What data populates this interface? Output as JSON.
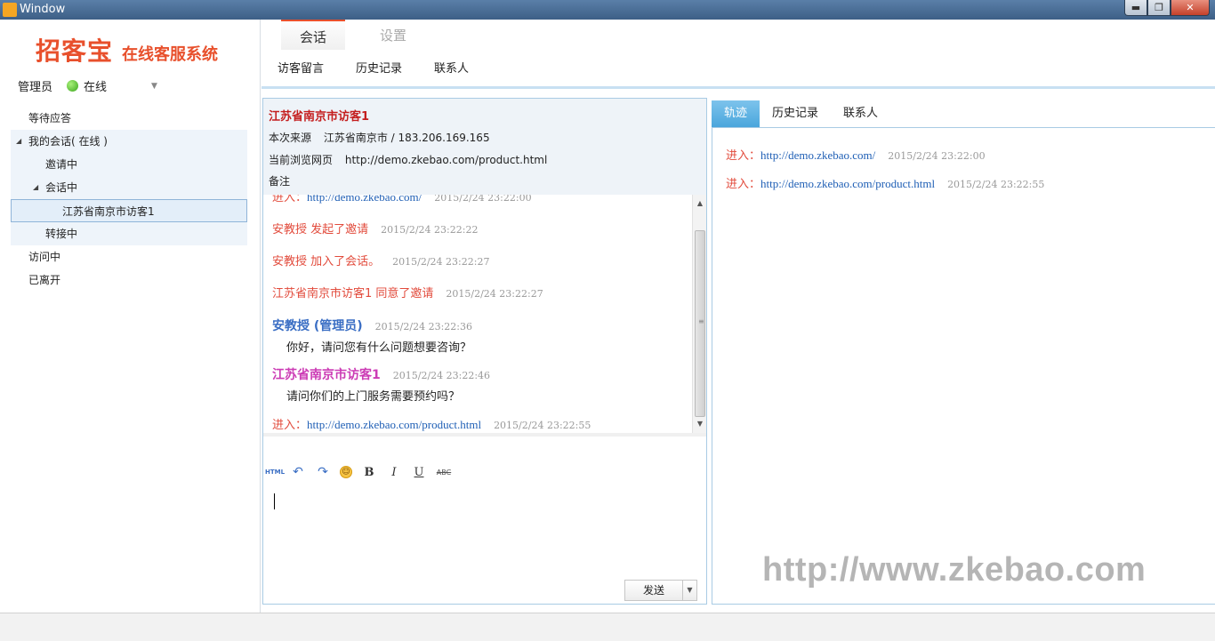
{
  "window": {
    "title": "Window",
    "minimize": "▬",
    "maximize": "❐",
    "close": "✕"
  },
  "logo": {
    "main": "招客宝",
    "sub": "在线客服系统"
  },
  "user": {
    "role": "管理员",
    "status": "在线",
    "status_color": "#3aa61c"
  },
  "tree": {
    "waiting": "等待应答",
    "my_sessions": "我的会话( 在线 )",
    "inviting": "邀请中",
    "in_session": "会话中",
    "visitor": "江苏省南京市访客1",
    "transferring": "转接中",
    "visiting": "访问中",
    "left": "已离开"
  },
  "tabs": {
    "session": "会话",
    "settings": "设置"
  },
  "subnav": {
    "messages": "访客留言",
    "history": "历史记录",
    "contacts": "联系人"
  },
  "visitor_info": {
    "name": "江苏省南京市访客1",
    "source_label": "本次来源",
    "source_value": "江苏省南京市  /  183.206.169.165",
    "page_label": "当前浏览网页",
    "page_value": "http://demo.zkebao.com/product.html",
    "note_label": "备注"
  },
  "messages": {
    "m0": {
      "label": "进入：",
      "link": "http://demo.zkebao.com/",
      "time": "2015/2/24 23:22:00"
    },
    "m1": {
      "text": "安教授 发起了邀请",
      "time": "2015/2/24 23:22:22"
    },
    "m2": {
      "text": "安教授 加入了会话。",
      "time": "2015/2/24 23:22:27"
    },
    "m3": {
      "text": "江苏省南京市访客1 同意了邀请",
      "time": "2015/2/24 23:22:27"
    },
    "m4": {
      "name": "安教授 (管理员)",
      "time": "2015/2/24 23:22:36",
      "body": "你好，请问您有什么问题想要咨询？"
    },
    "m5": {
      "name": "江苏省南京市访客1",
      "time": "2015/2/24 23:22:46",
      "body": "请问你们的上门服务需要预约吗？"
    },
    "m6": {
      "label": "进入：",
      "link": "http://demo.zkebao.com/product.html",
      "time": "2015/2/24 23:22:55"
    }
  },
  "editor": {
    "html": "HTML",
    "undo": "↶",
    "redo": "↷",
    "emoji": "☺",
    "bold": "B",
    "italic": "I",
    "underline": "U",
    "strike": "ABC"
  },
  "send": {
    "label": "发送",
    "arrow": "▼"
  },
  "right_tabs": {
    "track": "轨迹",
    "history": "历史记录",
    "contacts": "联系人"
  },
  "track": [
    {
      "label": "进入：",
      "link": "http://demo.zkebao.com/",
      "time": "2015/2/24 23:22:00"
    },
    {
      "label": "进入：",
      "link": "http://demo.zkebao.com/product.html",
      "time": "2015/2/24 23:22:55"
    }
  ],
  "watermark": "http://www.zkebao.com",
  "colors": {
    "brand": "#e8502c",
    "link": "#1f5fb5",
    "agent": "#3a6ec4",
    "customer": "#cc3cb5",
    "system": "#e24b3c",
    "tab_active": "#4aa6dc"
  }
}
